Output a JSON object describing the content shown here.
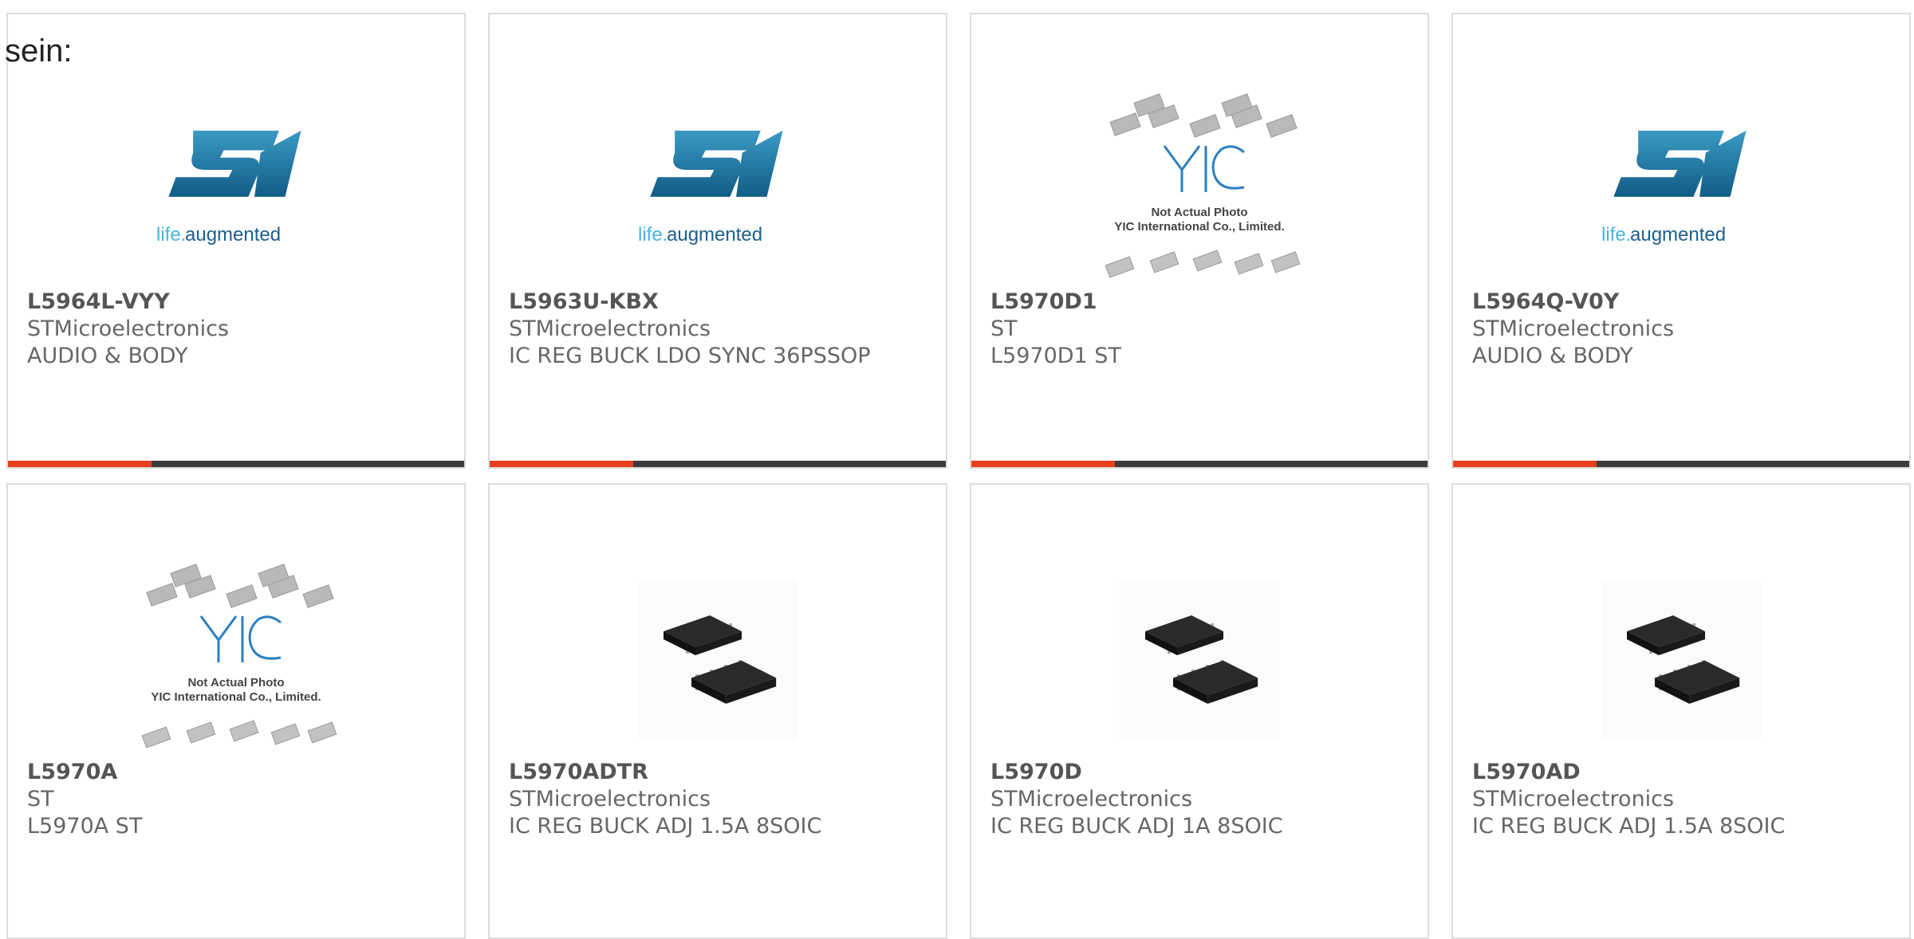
{
  "lead_text": "sein:",
  "colors": {
    "accent": "#e8401c",
    "bar": "#3c3c3c",
    "border": "#dddddd",
    "st_blue": "#1d6e9c"
  },
  "products": [
    {
      "part": "L5964L-VYY",
      "maker": "STMicroelectronics",
      "desc": "AUDIO & BODY",
      "image": "st-logo",
      "logo_tagline_a": "life.",
      "logo_tagline_b": "augmented"
    },
    {
      "part": "L5963U-KBX",
      "maker": "STMicroelectronics",
      "desc": "IC REG BUCK LDO SYNC 36PSSOP",
      "image": "st-logo",
      "logo_tagline_a": "life.",
      "logo_tagline_b": "augmented"
    },
    {
      "part": "L5970D1",
      "maker": "ST",
      "desc": "L5970D1 ST",
      "image": "yic-placeholder",
      "ph_line1": "Not Actual Photo",
      "ph_line2": "YIC International Co., Limited."
    },
    {
      "part": "L5964Q-V0Y",
      "maker": "STMicroelectronics",
      "desc": "AUDIO & BODY",
      "image": "st-logo",
      "logo_tagline_a": "life.",
      "logo_tagline_b": "augmented"
    },
    {
      "part": "L5970A",
      "maker": "ST",
      "desc": "L5970A ST",
      "image": "yic-placeholder",
      "ph_line1": "Not Actual Photo",
      "ph_line2": "YIC International Co., Limited."
    },
    {
      "part": "L5970ADTR",
      "maker": "STMicroelectronics",
      "desc": "IC REG BUCK ADJ 1.5A 8SOIC",
      "image": "soic-chip-photo"
    },
    {
      "part": "L5970D",
      "maker": "STMicroelectronics",
      "desc": "IC REG BUCK ADJ 1A 8SOIC",
      "image": "soic-chip-photo"
    },
    {
      "part": "L5970AD",
      "maker": "STMicroelectronics",
      "desc": "IC REG BUCK ADJ 1.5A 8SOIC",
      "image": "soic-chip-photo"
    }
  ]
}
